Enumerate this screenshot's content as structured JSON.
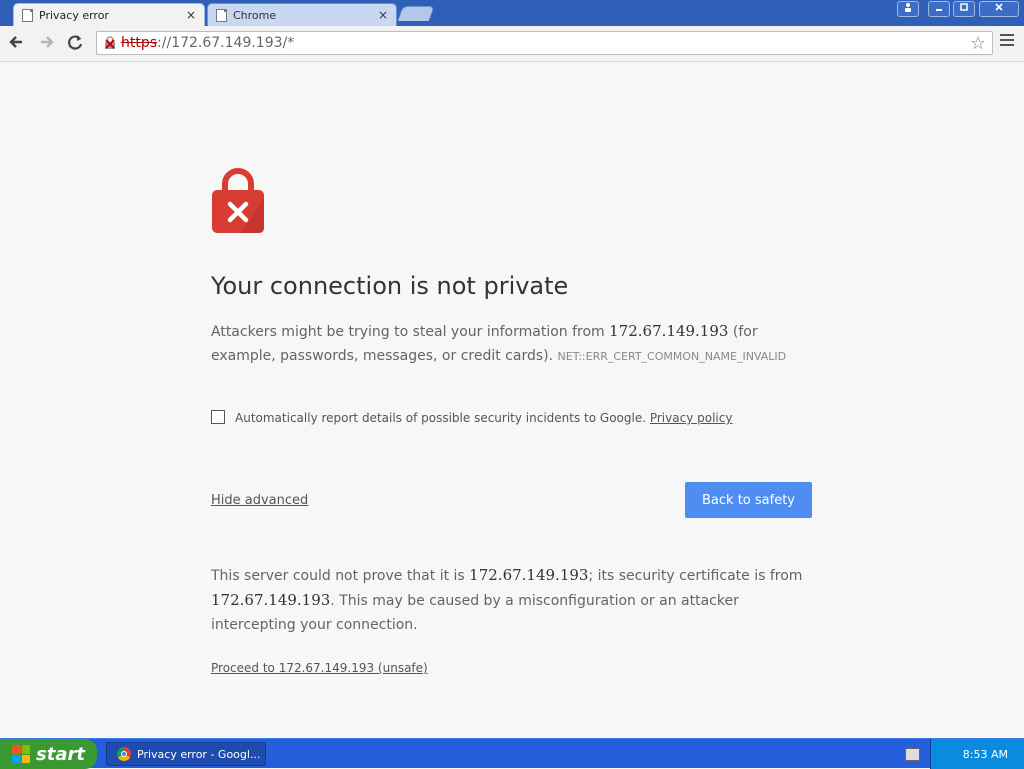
{
  "tabs": [
    {
      "title": "Privacy error",
      "close": "×"
    },
    {
      "title": "Chrome",
      "close": "×"
    }
  ],
  "window_controls": [
    "profile",
    "minimize",
    "maximize",
    "close"
  ],
  "address_bar": {
    "scheme": "https",
    "rest": "://172.67.149.193/*"
  },
  "error_page": {
    "heading": "Your connection is not private",
    "p1_before": "Attackers might be trying to steal your information from ",
    "host": "172.67.149.193",
    "p1_after": " (for example, passwords, messages, or credit cards). ",
    "error_code": "NET::ERR_CERT_COMMON_NAME_INVALID",
    "checkbox_label": "Automatically report details of possible security incidents to Google. ",
    "privacy_link": "Privacy policy",
    "checkbox_checked": false,
    "hide_advanced": "Hide advanced",
    "back_button": "Back to safety",
    "p2_a": "This server could not prove that it is ",
    "p2_b": "; its security certificate is from ",
    "p2_c": ". This may be caused by a misconfiguration or an attacker intercepting your connection.",
    "proceed_link": "Proceed to 172.67.149.193 (unsafe)"
  },
  "taskbar": {
    "start_label": "start",
    "window_item": "Privacy error - Googl...",
    "clock": "8:53 AM"
  },
  "colors": {
    "lock_red": "#d93c33",
    "button_blue": "#4e8ef2",
    "taskbar_blue": "#245edb",
    "start_green": "#3a9a31"
  }
}
